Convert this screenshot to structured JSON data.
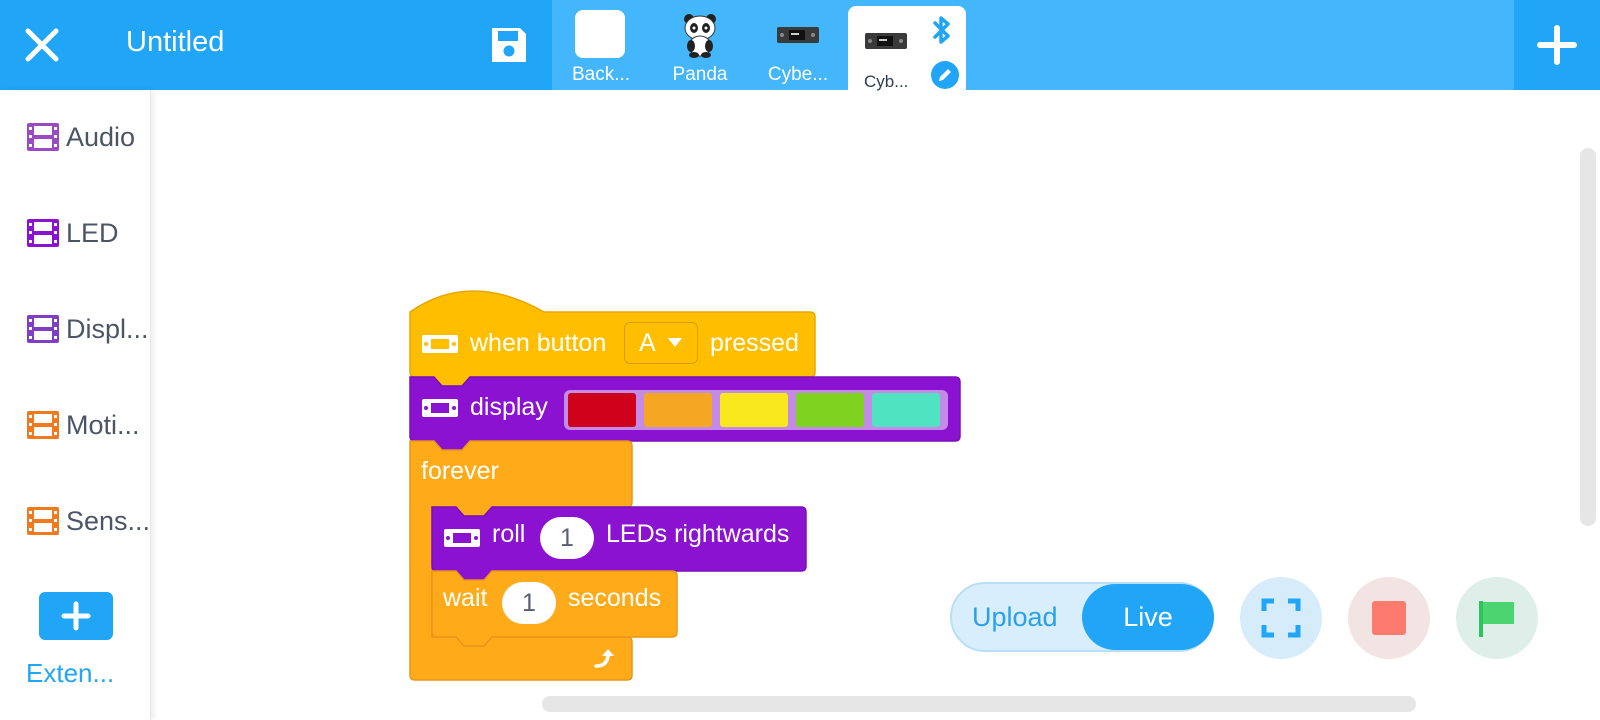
{
  "header": {
    "title": "Untitled",
    "close_icon": "close-icon",
    "save_icon": "save-icon",
    "add_icon": "plus-icon"
  },
  "sprites": [
    {
      "label": "Back...",
      "icon": "backdrop-icon"
    },
    {
      "label": "Panda",
      "icon": "panda-icon"
    },
    {
      "label": "Cybe...",
      "icon": "cyberpi-device-icon"
    },
    {
      "label": "Cyb...",
      "icon": "cyberpi-device-icon",
      "active": true
    }
  ],
  "active_device": {
    "bluetooth_icon": "bluetooth-icon",
    "edit_icon": "edit-pencil-icon"
  },
  "sidebar": {
    "categories": [
      {
        "label": "Audio",
        "color": "#9b4bc2"
      },
      {
        "label": "LED",
        "color": "#8a12d0"
      },
      {
        "label": "Displ...",
        "color": "#7e3fc4"
      },
      {
        "label": "Moti...",
        "color": "#f27a1e"
      },
      {
        "label": "Sens...",
        "color": "#f27a1e"
      }
    ],
    "extension_label": "Exten..."
  },
  "script": {
    "hat": {
      "pre": "when button",
      "dropdown": "A",
      "post": "pressed"
    },
    "display": {
      "label": "display",
      "colors": [
        "#d0021b",
        "#f5a623",
        "#f8e71c",
        "#7ed321",
        "#50e3c2"
      ]
    },
    "forever": {
      "label": "forever"
    },
    "roll": {
      "pre": "roll",
      "value": "1",
      "post": "LEDs rightwards"
    },
    "wait": {
      "pre": "wait",
      "value": "1",
      "post": "seconds"
    }
  },
  "controls": {
    "upload_label": "Upload",
    "live_label": "Live",
    "mode_selected": "Live",
    "fullscreen_icon": "fullscreen-icon",
    "stop_icon": "stop-icon",
    "start_icon": "green-flag-icon"
  },
  "colors": {
    "primary": "#21a5f7",
    "event": "#ffbf00",
    "control": "#ffab19",
    "led_block": "#8a12d0"
  }
}
